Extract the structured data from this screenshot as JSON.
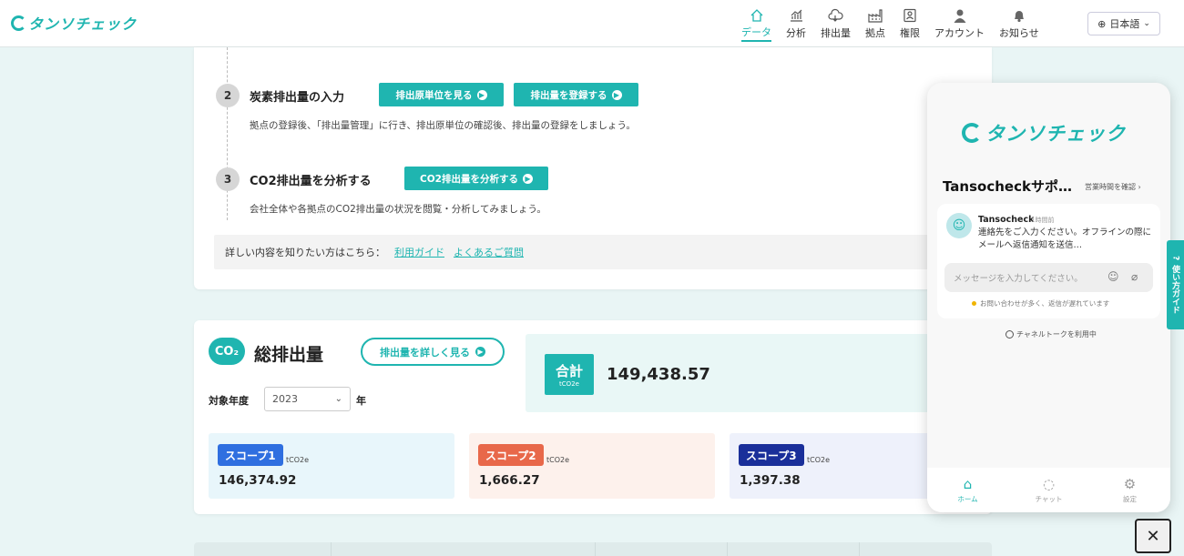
{
  "header": {
    "logo_text": "タンソチェック",
    "nav": [
      {
        "label": "データ",
        "icon": "home-icon",
        "active": true
      },
      {
        "label": "分析",
        "icon": "chart-icon",
        "active": false
      },
      {
        "label": "排出量",
        "icon": "cloud-icon",
        "active": false
      },
      {
        "label": "拠点",
        "icon": "factory-icon",
        "active": false
      },
      {
        "label": "権限",
        "icon": "id-card-icon",
        "active": false
      },
      {
        "label": "アカウント",
        "icon": "user-icon",
        "active": false
      },
      {
        "label": "お知らせ",
        "icon": "bell-icon",
        "active": false
      }
    ],
    "language": "日本語"
  },
  "steps": [
    {
      "number": "2",
      "title": "炭素排出量の入力",
      "buttons": [
        "排出原単位を見る",
        "排出量を登録する"
      ],
      "description": "拠点の登録後、「排出量管理」に行き、排出原単位の確認後、排出量の登録をしましょう。"
    },
    {
      "number": "3",
      "title": "CO2排出量を分析する",
      "buttons": [
        "CO2排出量を分析する"
      ],
      "description": "会社全体や各拠点のCO2排出量の状況を閲覧・分析してみましょう。"
    }
  ],
  "guide": {
    "prefix": "詳しい内容を知りたい方はこちら：",
    "links": [
      "利用ガイド",
      "よくあるご質問"
    ]
  },
  "total_emissions": {
    "icon_text": "CO₂",
    "title": "総排出量",
    "detail_button": "排出量を詳しく見る",
    "year_label": "対象年度",
    "year_value": "2023",
    "year_unit": "年",
    "total_label": "合計",
    "total_unit": "tCO2e",
    "total_value": "149,438.57",
    "scopes": [
      {
        "label": "スコープ1",
        "unit": "tCO2e",
        "value": "146,374.92",
        "color": "#2f6fe0",
        "bg": "#e8f6fb"
      },
      {
        "label": "スコープ2",
        "unit": "tCO2e",
        "value": "1,666.27",
        "color": "#e8684a",
        "bg": "#fdf1ec"
      },
      {
        "label": "スコープ3",
        "unit": "tCO2e",
        "value": "1,397.38",
        "color": "#1a2f9a",
        "bg": "#eef1fb"
      }
    ]
  },
  "chat": {
    "logo_text": "タンソチェック",
    "title": "Tansocheckサポ…",
    "hours_link": "営業時間を確認",
    "bot_name": "Tansocheck",
    "bot_time": "1時間前",
    "bot_message": "連絡先をご入力ください。オフラインの際にメールへ返信通知を送信…",
    "input_placeholder": "メッセージを入力してください。",
    "note": "お問い合わせが多く、返信が遅れています",
    "powered": "チャネルトークを利用中",
    "footer": [
      {
        "label": "ホーム",
        "icon": "home-icon",
        "active": true
      },
      {
        "label": "チャット",
        "icon": "chat-icon",
        "active": false
      },
      {
        "label": "設定",
        "icon": "gear-icon",
        "active": false
      }
    ]
  },
  "side_tab": "使い方ガイド",
  "close_label": "✕"
}
